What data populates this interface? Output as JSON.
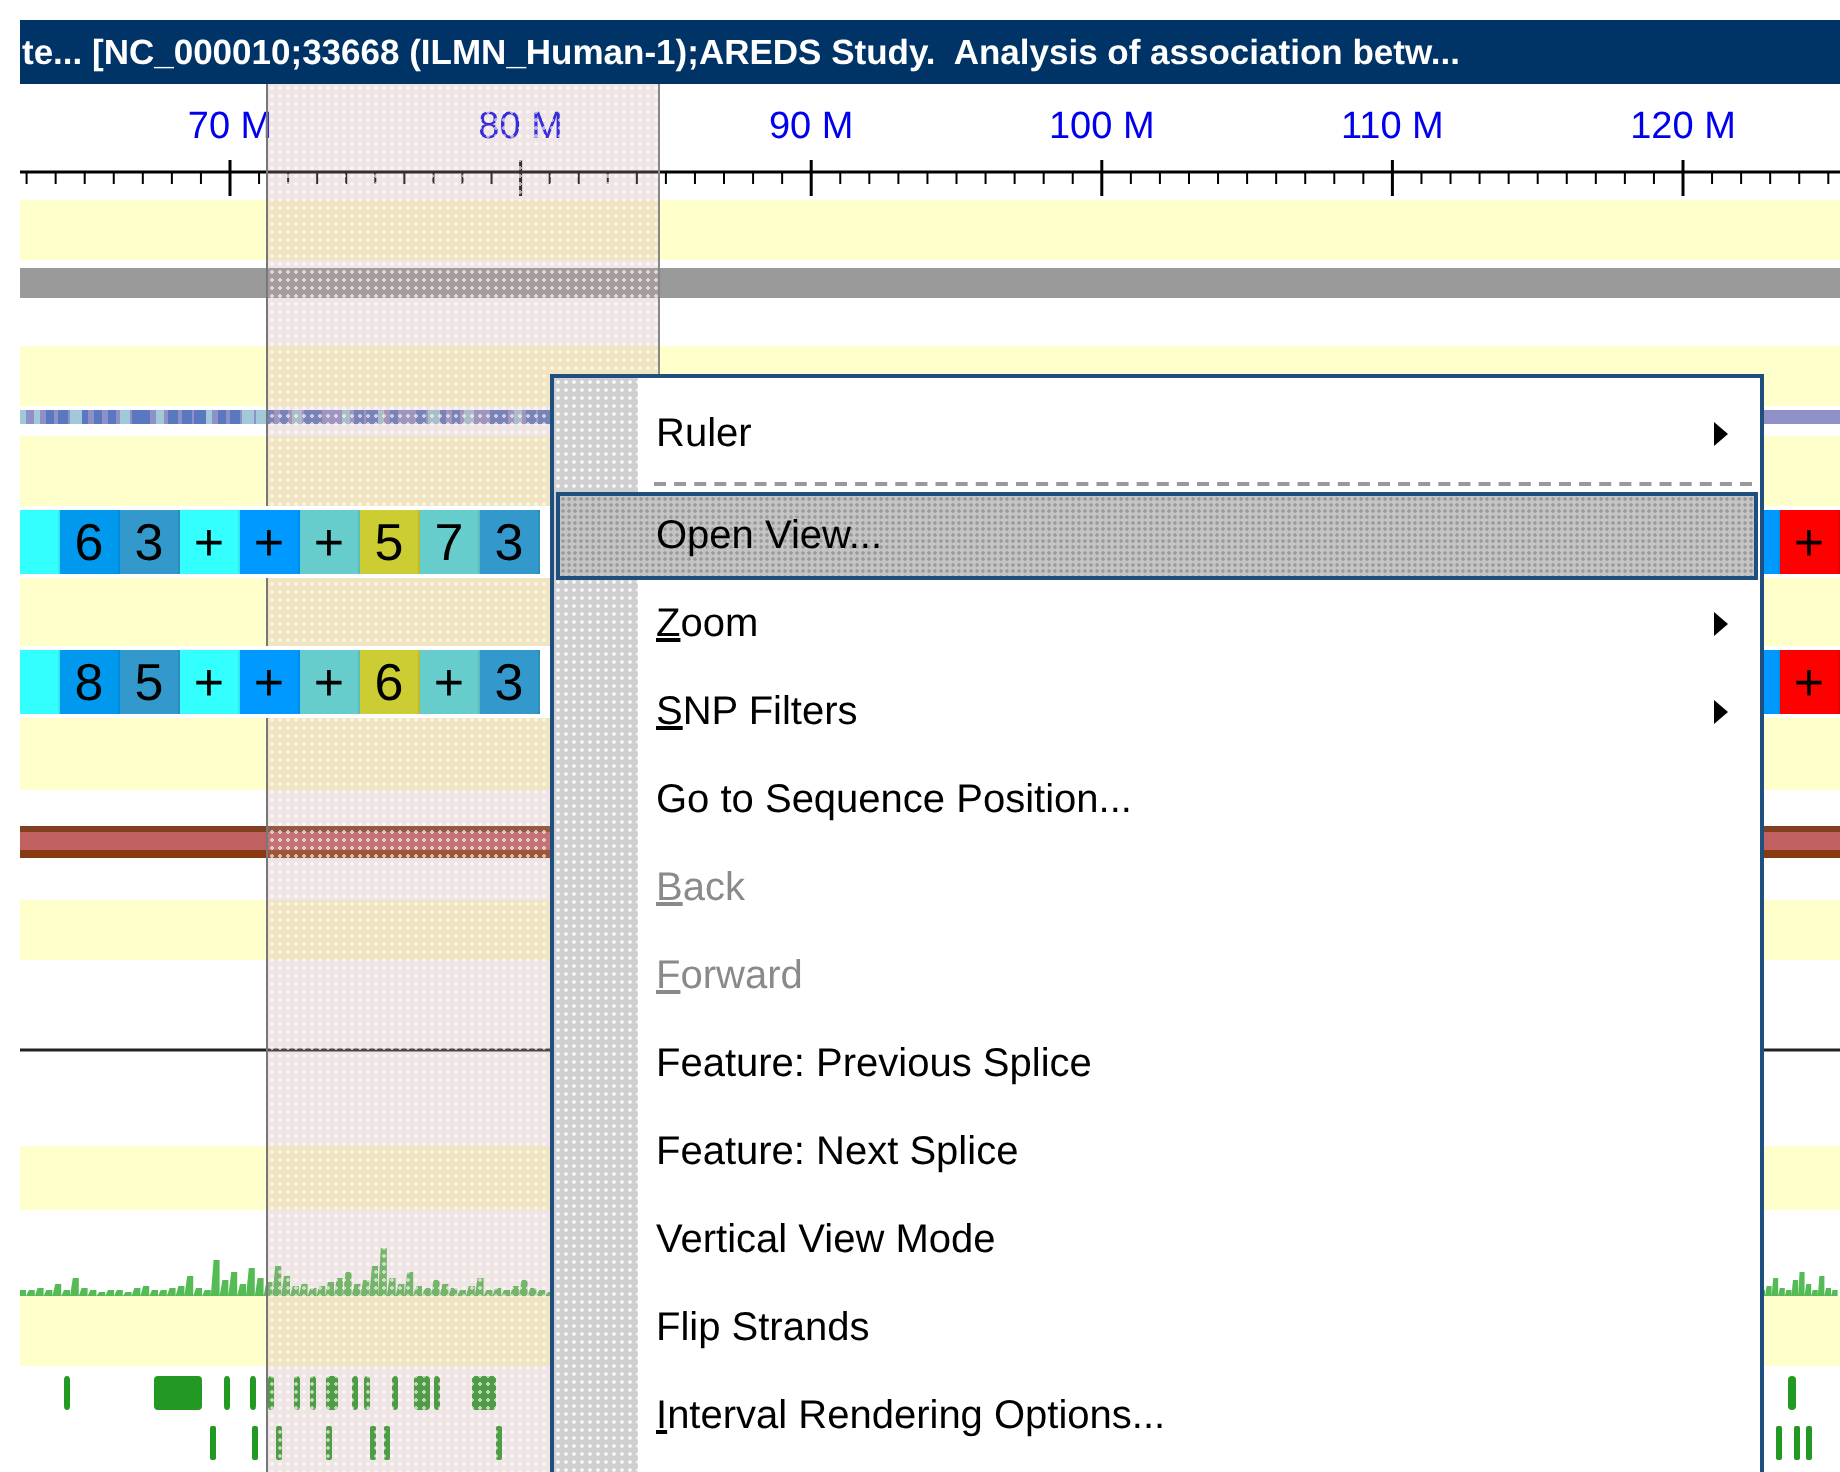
{
  "window": {
    "title": "te... [NC_000010;33668 (ILMN_Human-1);AREDS Study.  Analysis of association betw..."
  },
  "ruler": {
    "labels": [
      "70 M",
      "80 M",
      "90 M",
      "100 M",
      "110 M",
      "120 M"
    ]
  },
  "score_rows": [
    {
      "cells": [
        {
          "kind": "partial",
          "color": "#33ffff"
        },
        {
          "kind": "full",
          "text": "6",
          "color": "#0099ee"
        },
        {
          "kind": "full",
          "text": "3",
          "color": "#3399cc"
        },
        {
          "kind": "full",
          "text": "+",
          "color": "#33ffff"
        },
        {
          "kind": "full",
          "text": "+",
          "color": "#0099ff"
        },
        {
          "kind": "full",
          "text": "+",
          "color": "#66cccc"
        },
        {
          "kind": "full",
          "text": "5",
          "color": "#cccc33"
        },
        {
          "kind": "full",
          "text": "7",
          "color": "#66cccc"
        },
        {
          "kind": "full",
          "text": "3",
          "color": "#3399cc"
        }
      ],
      "right_cells": [
        {
          "kind": "partial",
          "color": "#0099ff"
        },
        {
          "kind": "full",
          "text": "+",
          "color": "#ff0000"
        }
      ]
    },
    {
      "cells": [
        {
          "kind": "partial",
          "color": "#33ffff"
        },
        {
          "kind": "full",
          "text": "8",
          "color": "#0099ee"
        },
        {
          "kind": "full",
          "text": "5",
          "color": "#3399cc"
        },
        {
          "kind": "full",
          "text": "+",
          "color": "#33ffff"
        },
        {
          "kind": "full",
          "text": "+",
          "color": "#0099ff"
        },
        {
          "kind": "full",
          "text": "+",
          "color": "#66cccc"
        },
        {
          "kind": "full",
          "text": "6",
          "color": "#cccc33"
        },
        {
          "kind": "full",
          "text": "+",
          "color": "#66cccc"
        },
        {
          "kind": "full",
          "text": "3",
          "color": "#3399cc"
        }
      ],
      "right_cells": [
        {
          "kind": "partial",
          "color": "#0099ff"
        },
        {
          "kind": "full",
          "text": "+",
          "color": "#ff0000"
        }
      ]
    }
  ],
  "context_menu": {
    "items": [
      {
        "label": "Ruler",
        "has_submenu": true,
        "disabled": false,
        "selected": false
      },
      {
        "kind": "separator"
      },
      {
        "label": "Open View...",
        "has_submenu": false,
        "disabled": false,
        "selected": true
      },
      {
        "label": "Zoom",
        "underline_first_letter": true,
        "has_submenu": true,
        "disabled": false,
        "selected": false
      },
      {
        "label": "SNP Filters",
        "underline_first_letter": true,
        "has_submenu": true,
        "disabled": false,
        "selected": false
      },
      {
        "label": "Go to Sequence Position...",
        "has_submenu": false,
        "disabled": false,
        "selected": false
      },
      {
        "label": "Back",
        "underline_first_letter": true,
        "has_submenu": false,
        "disabled": true,
        "selected": false
      },
      {
        "label": "Forward",
        "underline_first_letter": true,
        "has_submenu": false,
        "disabled": true,
        "selected": false
      },
      {
        "label": "Feature: Previous Splice",
        "has_submenu": false,
        "disabled": false,
        "selected": false
      },
      {
        "label": "Feature: Next Splice",
        "has_submenu": false,
        "disabled": false,
        "selected": false
      },
      {
        "label": "Vertical View Mode",
        "has_submenu": false,
        "disabled": false,
        "selected": false
      },
      {
        "label": "Flip Strands",
        "has_submenu": false,
        "disabled": false,
        "selected": false
      },
      {
        "label": "Interval Rendering Options...",
        "underline_first_letter": true,
        "has_submenu": false,
        "disabled": false,
        "selected": false
      }
    ]
  }
}
